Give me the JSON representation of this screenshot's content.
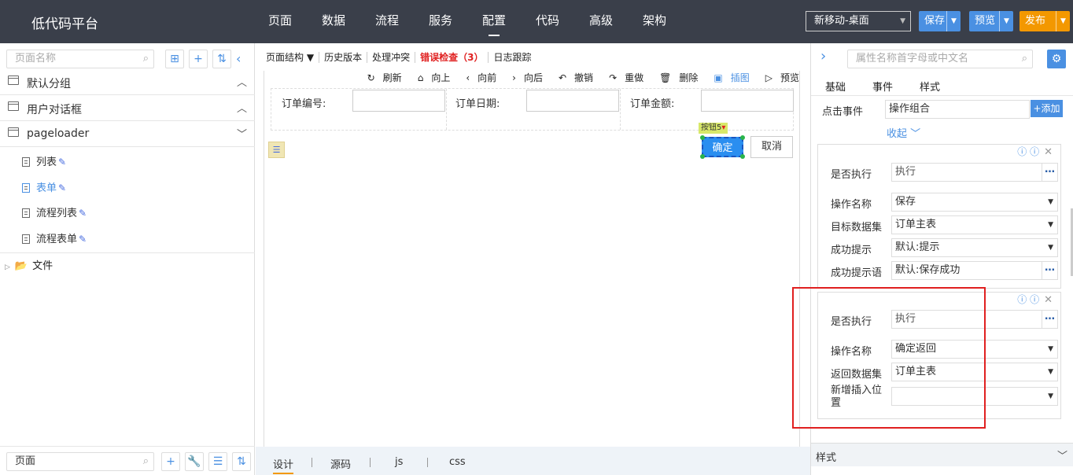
{
  "app": {
    "title": "低代码平台"
  },
  "topnav": {
    "items": [
      "页面",
      "数据",
      "流程",
      "服务",
      "配置",
      "代码",
      "高级",
      "架构"
    ],
    "active": "配置",
    "device": "新移动-桌面",
    "save": "保存",
    "preview": "预览",
    "publish": "发布"
  },
  "left": {
    "search_placeholder": "页面名称",
    "groups": [
      {
        "label": "默认分组",
        "state": "collapsed"
      },
      {
        "label": "用户对话框",
        "state": "collapsed"
      },
      {
        "label": "pageloader",
        "state": "expanded"
      }
    ],
    "pages": [
      {
        "label": "列表"
      },
      {
        "label": "表单",
        "selected": true
      },
      {
        "label": "流程列表"
      },
      {
        "label": "流程表单"
      }
    ],
    "files": "文件",
    "bottom_search": "页面"
  },
  "center": {
    "toolbar": {
      "structure": "页面结构",
      "history": "历史版本",
      "conflict": "处理冲突",
      "errors": "错误检查（3）",
      "log": "日志跟踪"
    },
    "tools": {
      "refresh": "刷新",
      "up": "向上",
      "forward": "向前",
      "back": "向后",
      "undo": "撤销",
      "redo": "重做",
      "delete": "删除",
      "insert_image": "插图",
      "preview": "预览"
    },
    "form": {
      "fields": [
        {
          "label": "订单编号:"
        },
        {
          "label": "订单日期:"
        },
        {
          "label": "订单金额:"
        }
      ],
      "confirm": "确定",
      "cancel": "取消",
      "button_tag": "按钮5"
    },
    "tabs": [
      "设计",
      "源码",
      "js",
      "css"
    ],
    "active_tab": "设计"
  },
  "right": {
    "search_placeholder": "属性名称首字母或中文名",
    "tabs": [
      "基础",
      "事件",
      "样式"
    ],
    "click_event_label": "点击事件",
    "click_event_value": "操作组合",
    "add": "+添加",
    "collapse": "收起",
    "card1": {
      "rows": [
        {
          "label": "是否执行",
          "value": "执行"
        },
        {
          "label": "操作名称",
          "value": "保存"
        },
        {
          "label": "目标数据集",
          "value": "订单主表"
        },
        {
          "label": "成功提示",
          "value": "默认:提示"
        },
        {
          "label": "成功提示语",
          "value": "默认:保存成功"
        }
      ]
    },
    "card2": {
      "rows": [
        {
          "label": "是否执行",
          "value": "执行"
        },
        {
          "label": "操作名称",
          "value": "确定返回"
        },
        {
          "label": "返回数据集",
          "value": "订单主表"
        },
        {
          "label": "新增插入位置",
          "value": ""
        }
      ]
    },
    "style_section": "样式",
    "highlight_color": "#e02020",
    "accent_color": "#4a90e2"
  }
}
